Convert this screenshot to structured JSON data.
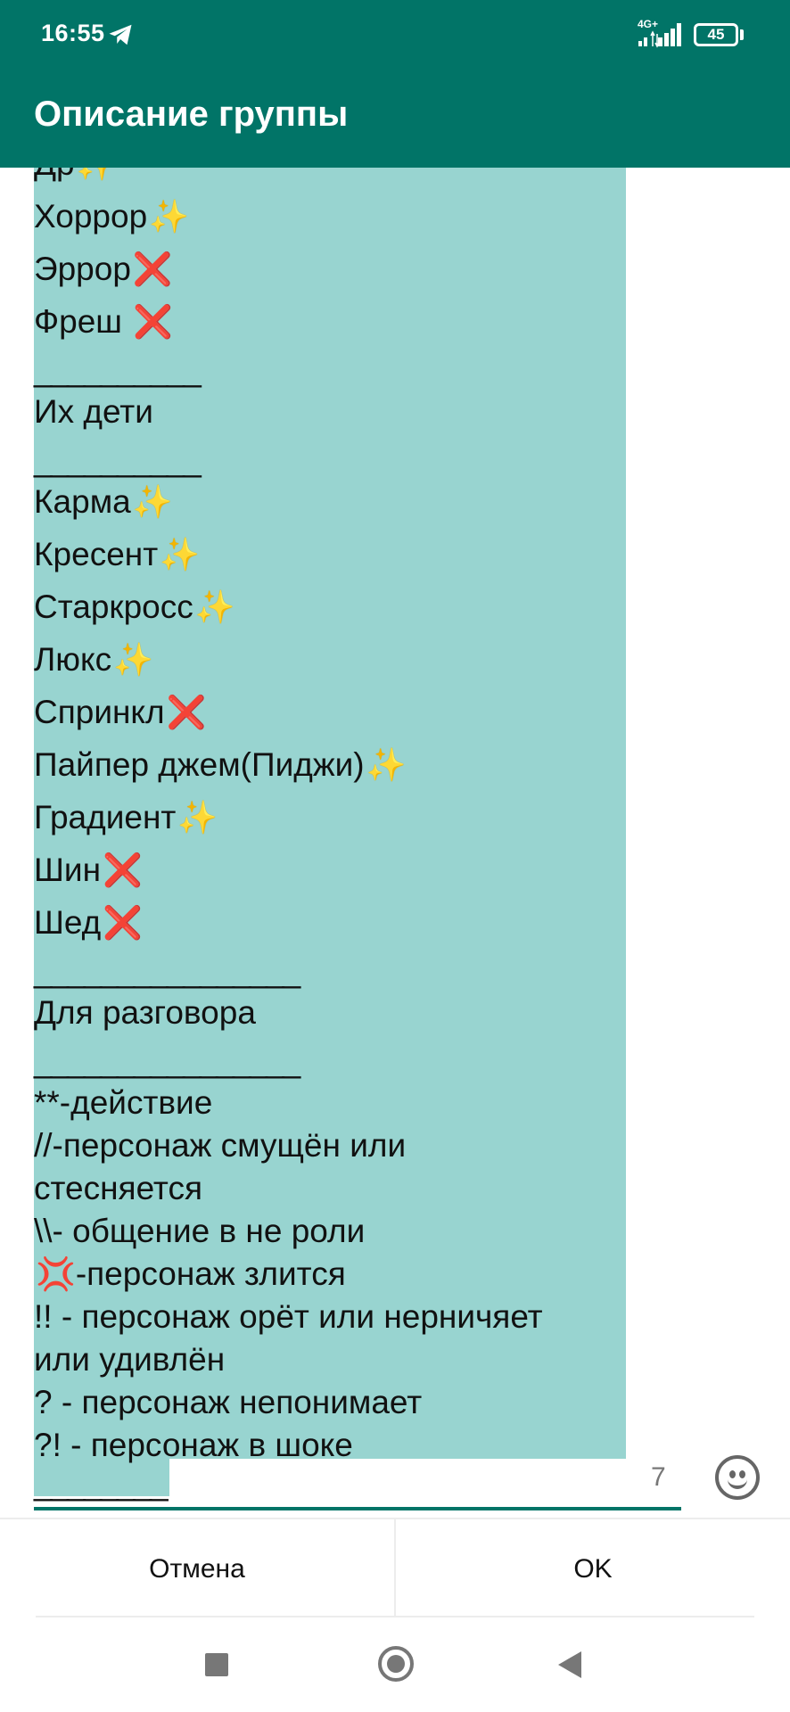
{
  "status_bar": {
    "time": "16:55",
    "network": "4G+",
    "battery": "45"
  },
  "app_bar": {
    "title": "Описание группы"
  },
  "description": {
    "lines": [
      {
        "text": "Др",
        "emoji": "✨",
        "kind": "spark"
      },
      {
        "text": "Хоррор",
        "emoji": "✨",
        "kind": "spark"
      },
      {
        "text": "Эррор",
        "emoji": "❌",
        "kind": "cross"
      },
      {
        "text": "Фреш ",
        "emoji": "❌",
        "kind": "cross"
      },
      {
        "text": "__________",
        "kind": "sep"
      },
      {
        "text": "Их дети",
        "kind": "plain"
      },
      {
        "text": "__________",
        "kind": "sep"
      },
      {
        "text": "Карма",
        "emoji": "✨",
        "kind": "spark"
      },
      {
        "text": "Кресент",
        "emoji": "✨",
        "kind": "spark"
      },
      {
        "text": "Старкросс",
        "emoji": "✨",
        "kind": "spark"
      },
      {
        "text": "Люкс",
        "emoji": "✨",
        "kind": "spark"
      },
      {
        "text": "Спринкл",
        "emoji": "❌",
        "kind": "cross"
      },
      {
        "text": "Пайпер джем(Пиджи)",
        "emoji": "✨",
        "kind": "spark"
      },
      {
        "text": "Градиент",
        "emoji": "✨",
        "kind": "spark"
      },
      {
        "text": "Шин",
        "emoji": "❌",
        "kind": "cross"
      },
      {
        "text": "Шед",
        "emoji": "❌",
        "kind": "cross"
      },
      {
        "text": "________________",
        "kind": "sep"
      },
      {
        "text": "Для разговора",
        "kind": "plain"
      },
      {
        "text": "________________",
        "kind": "sep"
      },
      {
        "text": "**-действие",
        "kind": "text"
      },
      {
        "text": "//-персонаж смущён или",
        "kind": "text"
      },
      {
        "text": "стесняется",
        "kind": "text"
      },
      {
        "text": "\\\\- общение в не роли",
        "kind": "text"
      },
      {
        "text": "-персонаж злится",
        "emoji": "💢",
        "kind": "anger"
      },
      {
        "text": "!! - персонаж орёт или нерничяет",
        "kind": "text"
      },
      {
        "text": "или удивлён",
        "kind": "text"
      },
      {
        "text": "? - персонаж непонимает",
        "kind": "text"
      },
      {
        "text": "?! - персонаж в шоке",
        "kind": "text"
      },
      {
        "text": "________",
        "kind": "sep"
      }
    ],
    "char_counter": "7"
  },
  "dialog": {
    "cancel_label": "Отмена",
    "ok_label": "OK"
  },
  "colors": {
    "primary": "#017467",
    "selection": "#98d4d0"
  },
  "icons": {
    "emoji_button": "smiley-face-icon",
    "telegram": "telegram-plane-icon",
    "nav_recents": "square-icon",
    "nav_home": "circle-icon",
    "nav_back": "triangle-back-icon"
  }
}
